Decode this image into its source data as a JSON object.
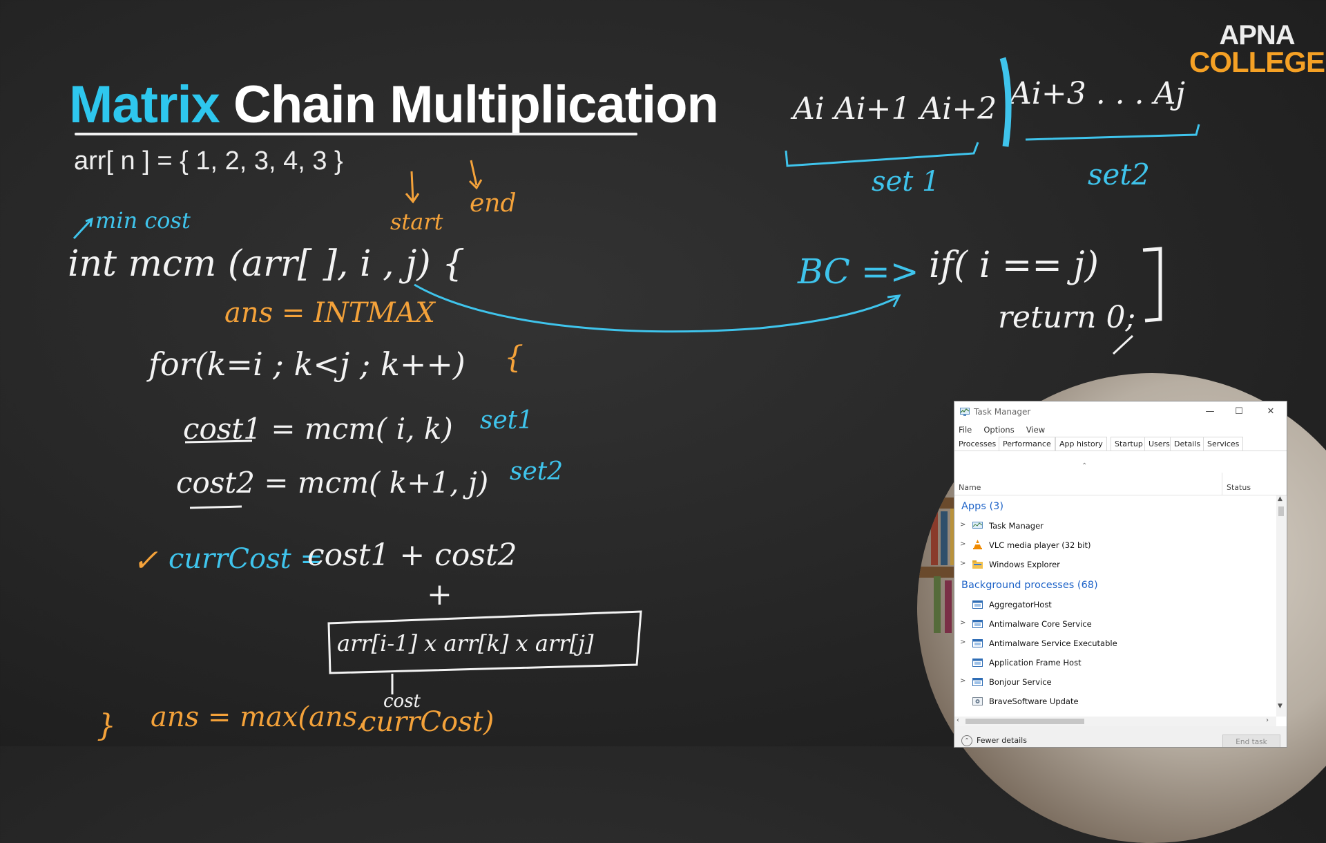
{
  "title": {
    "accent": "Matrix",
    "rest": "Chain Multiplication"
  },
  "array_line": "arr[ n ] = { 1, 2, 3, 4, 3 }",
  "logo": {
    "line1": "APNA",
    "line2": "COLLEGE"
  },
  "notes": {
    "min_cost": "min cost",
    "start": "start",
    "end": "end",
    "func_sig": "int mcm (arr[ ], i , j)  {",
    "ans_init": "ans = INTMAX",
    "for_loop": "for(k=i ; k<j ; k++)",
    "brace_open": "{",
    "cost1": "cost1 = mcm( i, k)",
    "set1_small": "set1",
    "cost2": "cost2 = mcm( k+1, j)",
    "set2_small": "set2",
    "check": "✓",
    "currcost_label": "currCost =",
    "currcost_expr": "cost1 + cost2",
    "plus": "+",
    "product": "arr[i-1] x arr[k] x arr[j]",
    "cost_label": "cost",
    "close_brace": "}",
    "ans_update_a": "ans = max(ans,",
    "ans_update_b": "currCost)",
    "chain_left": "Ai Ai+1 Ai+2",
    "chain_right": "Ai+3 . . . Aj",
    "set1_label": "set 1",
    "set2_label": "set2",
    "bc_label": "BC =>",
    "bc_if": "if( i == j)",
    "bc_return": "return 0;"
  },
  "task_manager": {
    "title": "Task Manager",
    "menu": [
      "File",
      "Options",
      "View"
    ],
    "tabs": [
      "Processes",
      "Performance",
      "App history",
      "Startup",
      "Users",
      "Details",
      "Services"
    ],
    "columns": {
      "name": "Name",
      "status": "Status"
    },
    "apps_header": "Apps (3)",
    "apps": [
      {
        "label": "Task Manager",
        "expandable": true,
        "icon": "task-manager-icon"
      },
      {
        "label": "VLC media player (32 bit)",
        "expandable": true,
        "icon": "vlc-cone-icon"
      },
      {
        "label": "Windows Explorer",
        "expandable": true,
        "icon": "folder-icon"
      }
    ],
    "bg_header": "Background processes (68)",
    "background": [
      {
        "label": "AggregatorHost",
        "expandable": false,
        "icon": "window-process-icon"
      },
      {
        "label": "Antimalware Core Service",
        "expandable": true,
        "icon": "window-process-icon"
      },
      {
        "label": "Antimalware Service Executable",
        "expandable": true,
        "icon": "window-process-icon"
      },
      {
        "label": "Application Frame Host",
        "expandable": false,
        "icon": "window-process-icon"
      },
      {
        "label": "Bonjour Service",
        "expandable": true,
        "icon": "window-process-icon"
      },
      {
        "label": "BraveSoftware Update",
        "expandable": false,
        "icon": "setup-icon"
      }
    ],
    "footer": {
      "fewer": "Fewer details",
      "end_task": "End task"
    },
    "colors": {
      "link_blue": "#1f64c8",
      "window_bg": "#ffffff"
    }
  },
  "colors": {
    "title_accent": "#2ec7ee",
    "logo_orange": "#f5a125",
    "chalk_blue": "#3fc4ec",
    "chalk_orange": "#f4a23a"
  }
}
